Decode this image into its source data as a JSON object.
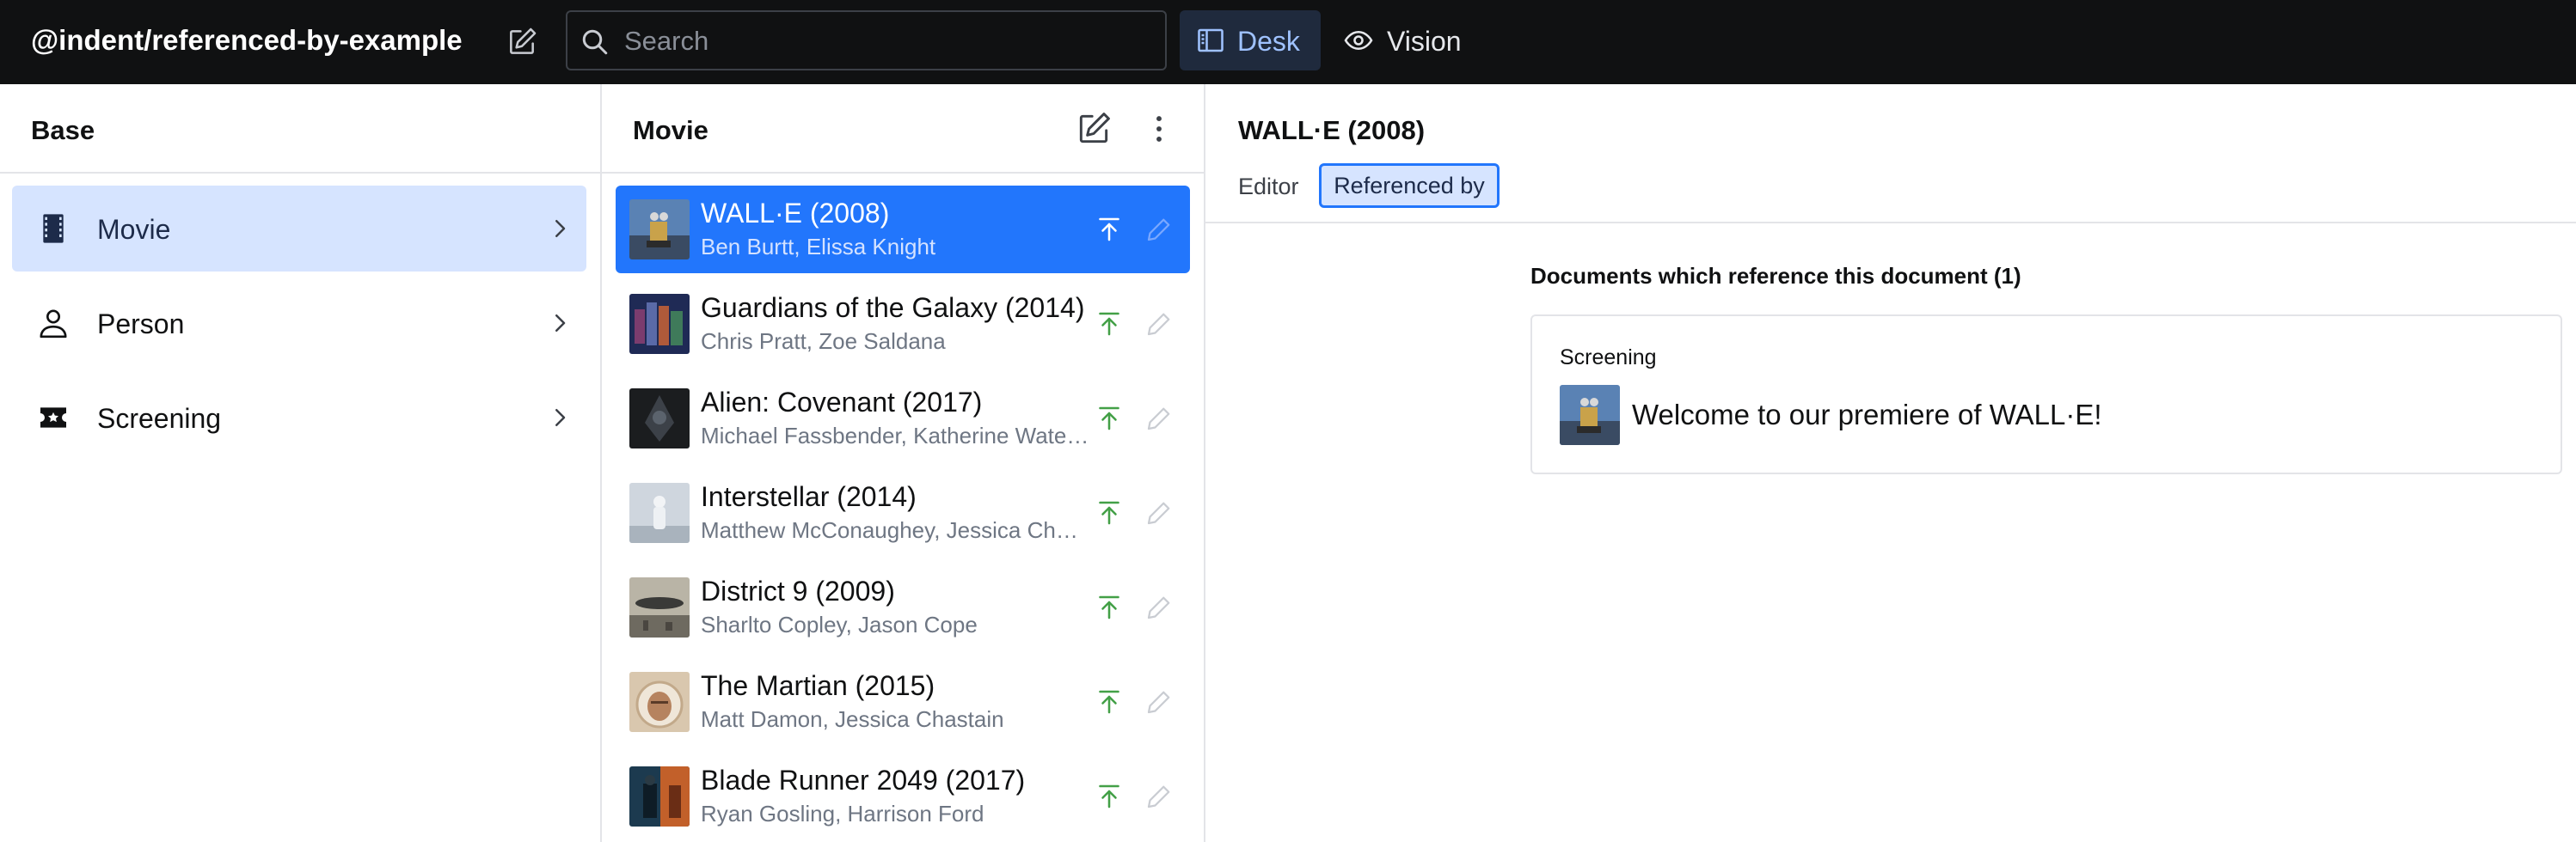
{
  "navbar": {
    "workspace_title": "@indent/referenced-by-example",
    "compose_icon": "compose-icon",
    "search": {
      "placeholder": "Search",
      "value": ""
    },
    "tools": [
      {
        "label": "Desk",
        "icon": "desk-icon",
        "active": true
      },
      {
        "label": "Vision",
        "icon": "eye-icon",
        "active": false
      }
    ]
  },
  "base_pane": {
    "title": "Base",
    "items": [
      {
        "label": "Movie",
        "icon": "film-icon",
        "selected": true
      },
      {
        "label": "Person",
        "icon": "person-icon",
        "selected": false
      },
      {
        "label": "Screening",
        "icon": "ticket-icon",
        "selected": false
      }
    ]
  },
  "movie_pane": {
    "title": "Movie",
    "items": [
      {
        "title": "WALL·E (2008)",
        "subtitle": "Ben Burtt, Elissa Knight",
        "selected": true
      },
      {
        "title": "Guardians of the Galaxy (2014)",
        "subtitle": "Chris Pratt, Zoe Saldana",
        "selected": false
      },
      {
        "title": "Alien: Covenant (2017)",
        "subtitle": "Michael Fassbender, Katherine Waterston",
        "selected": false
      },
      {
        "title": "Interstellar (2014)",
        "subtitle": "Matthew McConaughey, Jessica Chastain",
        "selected": false
      },
      {
        "title": "District 9 (2009)",
        "subtitle": "Sharlto Copley, Jason Cope",
        "selected": false
      },
      {
        "title": "The Martian (2015)",
        "subtitle": "Matt Damon, Jessica Chastain",
        "selected": false
      },
      {
        "title": "Blade Runner 2049 (2017)",
        "subtitle": "Ryan Gosling, Harrison Ford",
        "selected": false
      }
    ]
  },
  "document_pane": {
    "title": "WALL·E (2008)",
    "tabs": [
      {
        "label": "Editor",
        "active": false
      },
      {
        "label": "Referenced by",
        "active": true
      }
    ],
    "references_heading": "Documents which reference this document (1)",
    "references": [
      {
        "type": "Screening",
        "title": "Welcome to our premiere of WALL·E!"
      }
    ]
  },
  "colors": {
    "navbar_bg": "#101112",
    "accent": "#2276fc",
    "selected_bg": "#d6e4ff",
    "publish_green": "#43a047",
    "border": "#e3e4e8"
  }
}
